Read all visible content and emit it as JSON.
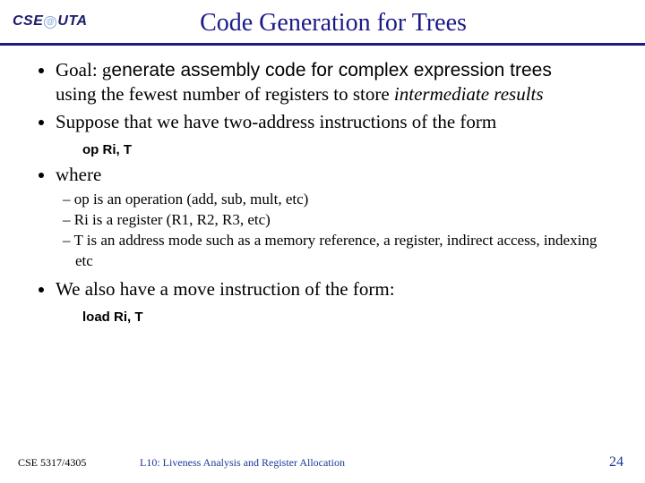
{
  "header": {
    "logo_left": "CSE",
    "logo_right": "UTA",
    "title": "Code Generation for Trees"
  },
  "bullets": {
    "b1_goal_prefix": "Goal: g",
    "b1_goal_sans": "enerate assembly code for complex expression trees",
    "b1_goal_line2a": "using the fewest number of registers to store ",
    "b1_goal_line2b": "intermediate results",
    "b2_suppose": "Suppose that we have two-address instructions of the form",
    "code1": "op   Ri, T",
    "b3_where": "where",
    "sub1": "op is an operation (add, sub, mult, etc)",
    "sub2": "Ri is a register (R1, R2, R3, etc)",
    "sub3": "T is an address mode such as a memory reference, a register, indirect access, indexing etc",
    "b4_move": "We also have a move instruction of the form:",
    "code2": "load   Ri, T"
  },
  "footer": {
    "course": "CSE 5317/4305",
    "lecture": "L10: Liveness Analysis and Register Allocation",
    "page": "24"
  }
}
